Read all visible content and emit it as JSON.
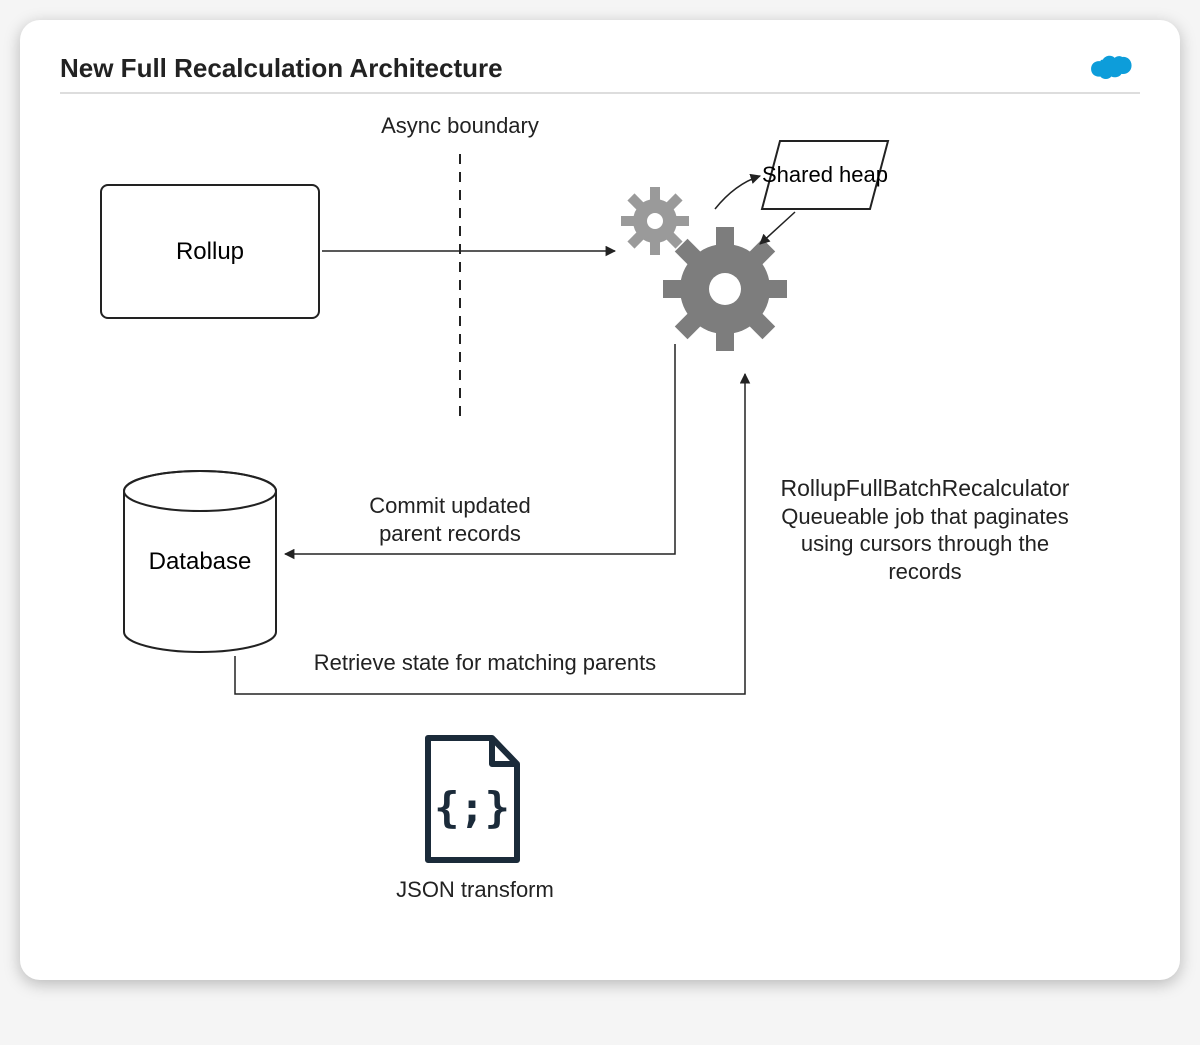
{
  "title": "New Full Recalculation Architecture",
  "nodes": {
    "rollup": "Rollup",
    "shared_heap": "Shared heap",
    "database": "Database",
    "json_transform": "JSON transform"
  },
  "labels": {
    "async_boundary": "Async boundary",
    "commit_line1": "Commit updated",
    "commit_line2": "parent records",
    "retrieve": "Retrieve state for matching parents",
    "recalc_title": "RollupFullBatchRecalculator",
    "recalc_desc1": "Queueable job that paginates",
    "recalc_desc2": "using cursors through the",
    "recalc_desc3": "records"
  },
  "colors": {
    "brand_cloud": "#0D9DDA",
    "stroke": "#222222",
    "gear": "#7d7d7d",
    "gear_light": "#9a9a9a"
  }
}
